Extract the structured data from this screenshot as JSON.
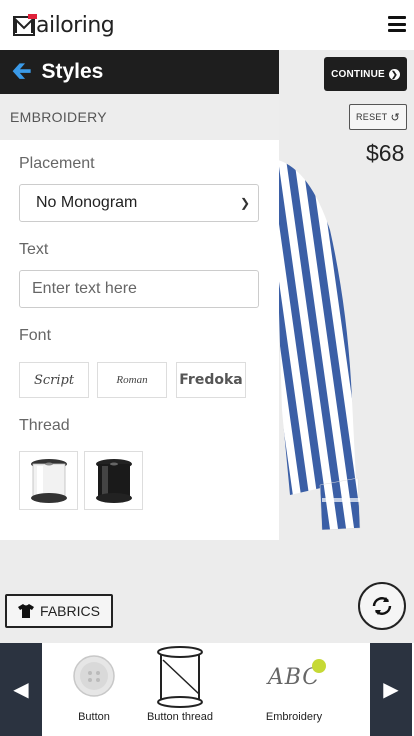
{
  "brand": {
    "logo_text": "ailoring"
  },
  "header": {
    "menu_icon": "hamburger-icon"
  },
  "stage": {
    "continue_label": "CONTINUE",
    "reset_label": "RESET",
    "price": "$68",
    "fabrics_label": "FABRICS"
  },
  "panel": {
    "title": "Styles",
    "section": "EMBROIDERY",
    "placement_label": "Placement",
    "placement_value": "No Monogram",
    "text_label": "Text",
    "text_placeholder": "Enter text here",
    "font_label": "Font",
    "fonts": [
      "Script",
      "Roman",
      "Fredoka"
    ],
    "thread_label": "Thread",
    "threads": [
      "white",
      "black"
    ]
  },
  "bottom_bar": {
    "items": [
      {
        "label": "Button"
      },
      {
        "label": "Button thread"
      },
      {
        "label": "Embroidery",
        "preview_text": "ABC"
      }
    ]
  },
  "colors": {
    "dark": "#1e1e1e",
    "accent_blue": "#3a9ae8",
    "nav_bg": "#2b3340",
    "shirt_blue": "#3b5fa6",
    "embroidery_dot": "#c6d935"
  }
}
